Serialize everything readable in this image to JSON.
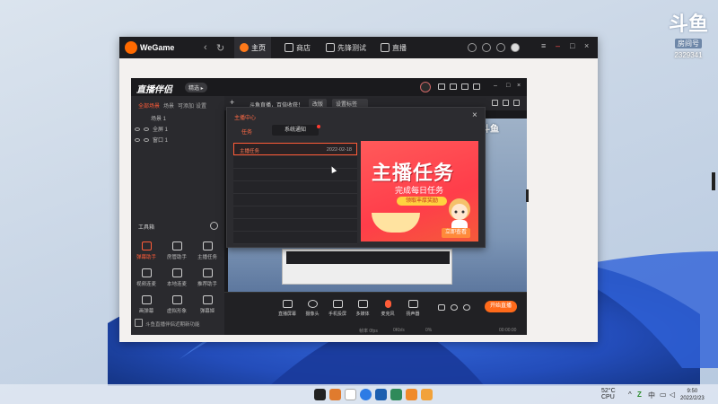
{
  "watermark": {
    "logo": "斗鱼",
    "sub": "房间号",
    "room": "2329341"
  },
  "wegame": {
    "brand": "WeGame",
    "nav_back": "‹",
    "nav_refresh": "↻",
    "tabs": [
      {
        "label": "主页",
        "icon": "home-icon"
      },
      {
        "label": "商店",
        "icon": "store-icon"
      },
      {
        "label": "先锋测试",
        "icon": "test-icon"
      },
      {
        "label": "直播",
        "icon": "live-icon"
      }
    ],
    "controls": {
      "menu": "≡",
      "minimize": "–",
      "maximize": "□",
      "close": "×"
    }
  },
  "app": {
    "logo": "直播伴侣",
    "badge": "精选 ▸",
    "controls": {
      "minimize": "–",
      "maximize": "□",
      "close": "×"
    },
    "side_tabs": [
      "全部场景",
      "场景",
      "可添加",
      "设置"
    ],
    "scenes": [
      {
        "label": "场景 1"
      },
      {
        "label": "全屏 1"
      },
      {
        "label": "窗口 1"
      }
    ],
    "tools_title": "工具箱",
    "tools": [
      {
        "label": "弹幕助手"
      },
      {
        "label": "房管助手"
      },
      {
        "label": "主播任务"
      },
      {
        "label": "视频连麦"
      },
      {
        "label": "本地连麦"
      },
      {
        "label": "推荐助手"
      },
      {
        "label": "画弹幕"
      },
      {
        "label": "虚拟形象"
      },
      {
        "label": "弹幕姬"
      }
    ],
    "side_news": "斗鱼直播伴侣近期新功能",
    "toolbar": {
      "plus": "+",
      "title": "斗鱼直播，百倍收获！",
      "btn1": "改版",
      "btn2": "设置标签"
    },
    "preview_watermark": "斗鱼",
    "bottom_buttons": [
      {
        "label": "直播屏幕"
      },
      {
        "label": "摄像头"
      },
      {
        "label": "手机投屏"
      },
      {
        "label": "多媒体"
      },
      {
        "label": "麦克风"
      },
      {
        "label": "扬声器"
      }
    ],
    "live_button": "开始直播",
    "status": {
      "left": "帧率 0fps",
      "mid1": "0Kb/s",
      "mid2": "0%",
      "right": "00:00:00"
    }
  },
  "modal": {
    "title": "主播中心",
    "close": "×",
    "tab_task": "任务",
    "tab_notice": "系统通知",
    "tasks": [
      {
        "name": "主播任务",
        "date": "2022-02-18",
        "active": true
      },
      {
        "name": "",
        "date": "",
        "active": false
      },
      {
        "name": "",
        "date": "",
        "active": false
      },
      {
        "name": "",
        "date": "",
        "active": false
      },
      {
        "name": "",
        "date": "",
        "active": false
      },
      {
        "name": "",
        "date": "",
        "active": false
      },
      {
        "name": "",
        "date": "",
        "active": false
      },
      {
        "name": "",
        "date": "",
        "active": false
      }
    ],
    "banner": {
      "title": "主播任务",
      "subtitle": "完成每日任务",
      "pill": "领取丰厚奖励",
      "button": "立即查看"
    }
  },
  "taskbar": {
    "weather_temp": "52°C",
    "weather_label": "CPU",
    "time": "9:50",
    "date": "2022/2/23",
    "lang": "中"
  },
  "colors": {
    "accent": "#ff5c38",
    "wegame_bar": "#1d1d20",
    "app_bg": "#222225"
  }
}
